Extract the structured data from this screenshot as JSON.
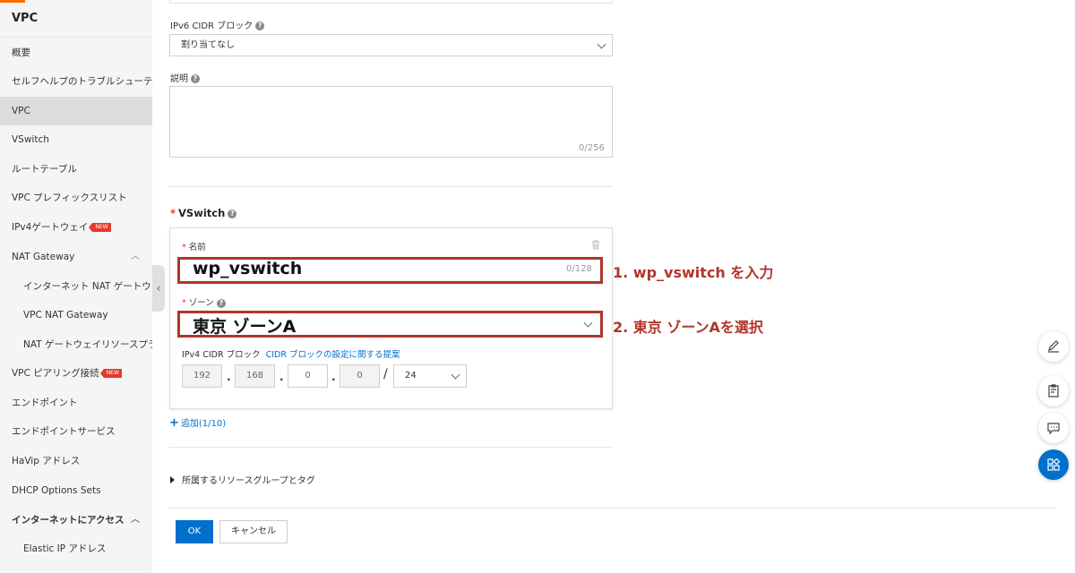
{
  "sidebar": {
    "title": "VPC",
    "items": [
      {
        "label": "概要"
      },
      {
        "label": "セルフヘルプのトラブルシューティング"
      },
      {
        "label": "VPC"
      },
      {
        "label": "VSwitch"
      },
      {
        "label": "ルートテーブル"
      },
      {
        "label": "VPC プレフィックスリスト"
      },
      {
        "label": "IPv4ゲートウェイ",
        "badge": "NEW"
      },
      {
        "label": "NAT Gateway"
      },
      {
        "label": "インターネット NAT ゲートウェイ"
      },
      {
        "label": "VPC NAT Gateway"
      },
      {
        "label": "NAT ゲートウェイリソースプラン"
      },
      {
        "label": "VPC ピアリング接続",
        "badge": "NEW"
      },
      {
        "label": "エンドポイント"
      },
      {
        "label": "エンドポイントサービス"
      },
      {
        "label": "HaVip アドレス"
      },
      {
        "label": "DHCP Options Sets"
      },
      {
        "label": "インターネットにアクセス"
      },
      {
        "label": "Elastic IP アドレス"
      }
    ]
  },
  "form": {
    "ipv6_label": "IPv6 CIDR ブロック",
    "ipv6_value": "割り当てなし",
    "desc_label": "説明",
    "desc_counter": "0/256",
    "vswitch_heading": "VSwitch",
    "name_label": "名前",
    "name_value": "wp_vswitch",
    "name_counter": "0/128",
    "zone_label": "ゾーン",
    "zone_value": "東京 ゾーンA",
    "ipv4_label": "IPv4 CIDR ブロック",
    "ipv4_link": "CIDR ブロックの設定に関する提案",
    "ip1": "192",
    "ip2": "168",
    "ip3": "0",
    "ip4": "0",
    "ip_sep": ".",
    "slash": "/",
    "mask": "24",
    "add_label": "追加(1/10)",
    "resource_group": "所属するリソースグループとタグ",
    "ok": "OK",
    "cancel": "キャンセル"
  },
  "annotations": {
    "step1": "1. wp_vswitch を入力",
    "step2": "2. 東京 ゾーンAを選択"
  },
  "colors": {
    "primary": "#0070cc",
    "annotation": "#b0352a",
    "badge": "#e8392f"
  }
}
